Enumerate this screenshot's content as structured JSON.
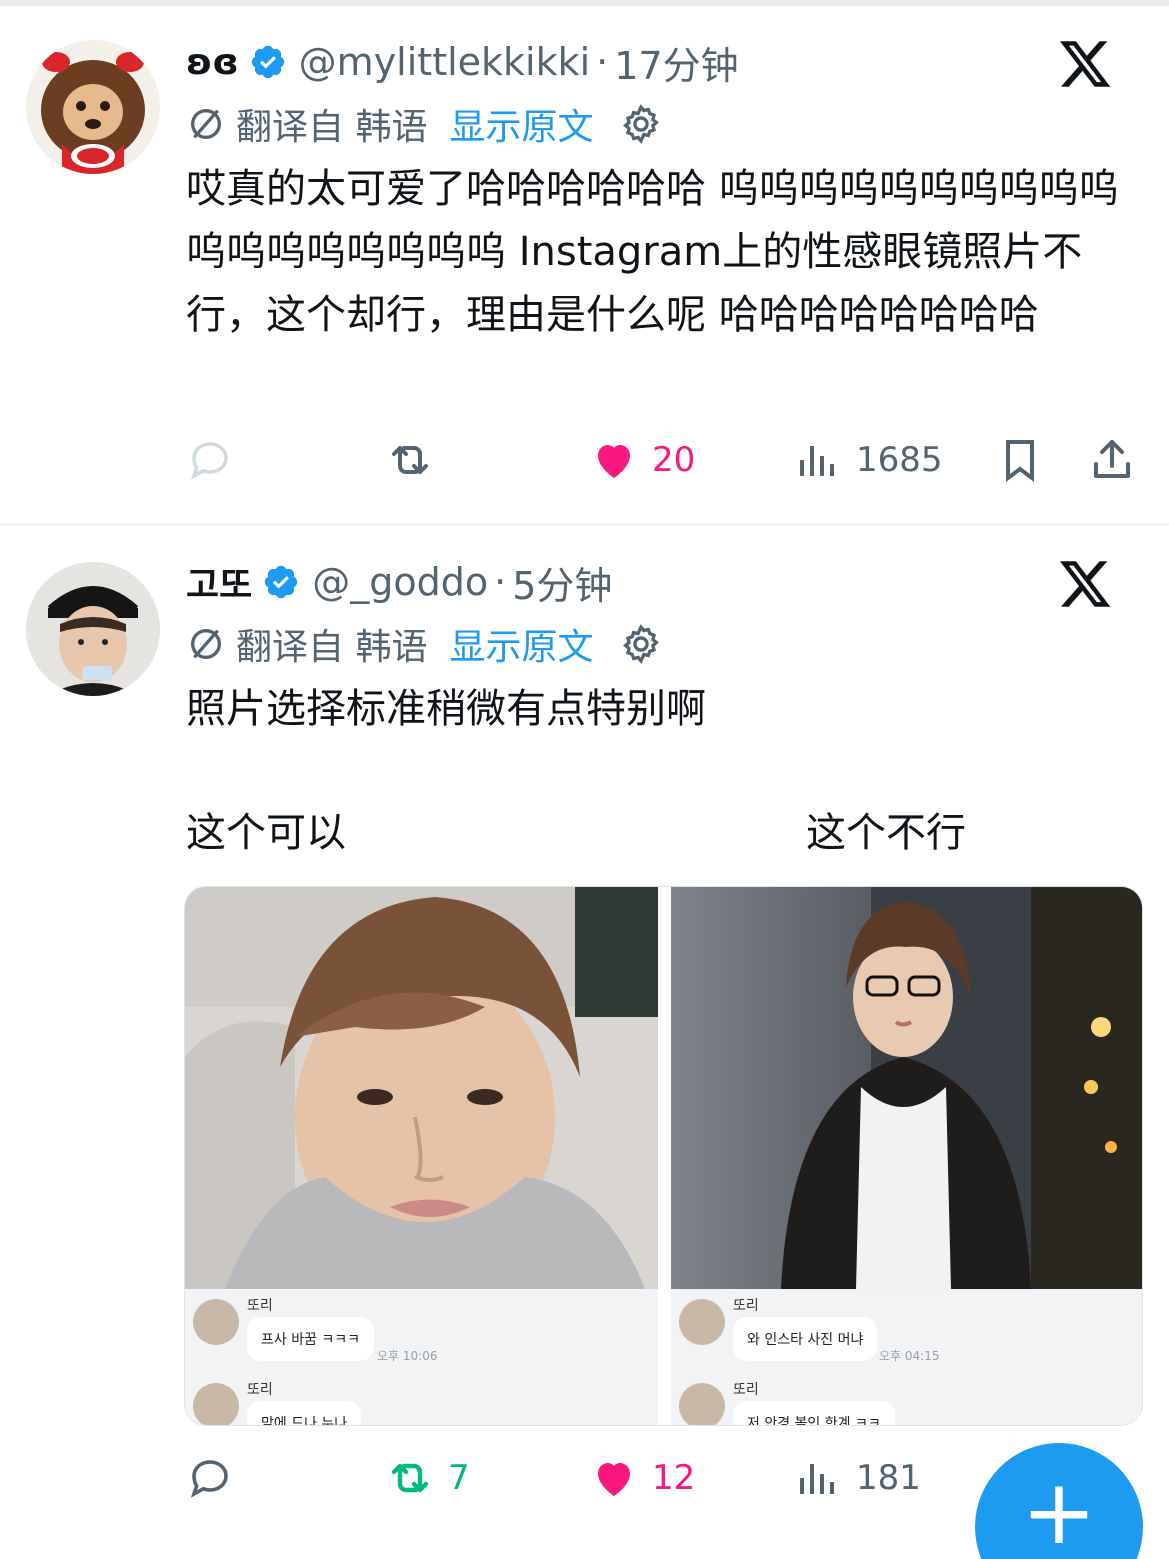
{
  "tweets": [
    {
      "name": "ʚɞ",
      "handle": "@mylittlekkikki",
      "dot": "·",
      "time": "17分钟",
      "translated_from": "翻译自 韩语",
      "show_original": "显示原文",
      "text": "哎真的太可爱了哈哈哈哈哈哈 呜呜呜呜呜呜呜呜呜呜呜呜呜呜呜呜呜呜 Instagram上的性感眼镜照片不行，这个却行，理由是什么呢 哈哈哈哈哈哈哈哈",
      "replies": "",
      "retweets": "",
      "likes": "20",
      "views": "1685",
      "liked": true,
      "retweeted": false
    },
    {
      "name": "고또",
      "handle": "@_goddo",
      "dot": "·",
      "time": "5分钟",
      "translated_from": "翻译自 韩语",
      "show_original": "显示原文",
      "text": "照片选择标准稍微有点特别啊",
      "caption_left": "这个可以",
      "caption_right": "这个不行",
      "replies": "",
      "retweets": "7",
      "likes": "12",
      "views": "181",
      "liked": true,
      "retweeted": true,
      "media": {
        "left_chat": {
          "name1": "또리",
          "msg1": "프사 바꿈 ㅋㅋㅋ",
          "time1": "오후 10:06",
          "name2": "또리",
          "msg2": "맘에 드나 누나"
        },
        "right_chat": {
          "name1": "또리",
          "msg1": "와 인스타 사진 머냐",
          "time1": "오후 04:15",
          "name2": "또리",
          "msg2": "저 안경 볼인 한계 ㅋㅋ"
        }
      }
    }
  ],
  "fab_label": "+",
  "colors": {
    "accent": "#1d9bf0",
    "like": "#f91880",
    "retweet": "#00ba7c",
    "secondary_text": "#536471"
  }
}
